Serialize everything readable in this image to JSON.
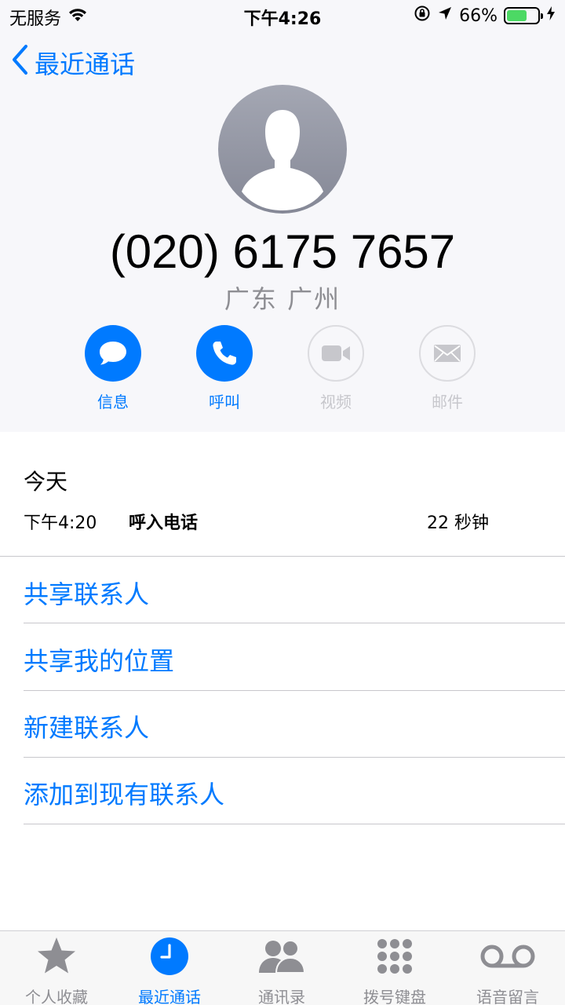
{
  "status_bar": {
    "carrier": "无服务",
    "time": "下午4:26",
    "battery_percent": "66%",
    "battery_level": 0.66
  },
  "nav": {
    "back_label": "最近通话"
  },
  "contact": {
    "phone_number": "(020) 6175 7657",
    "location": "广东 广州"
  },
  "actions": [
    {
      "label": "信息",
      "icon": "message-icon",
      "enabled": true
    },
    {
      "label": "呼叫",
      "icon": "phone-icon",
      "enabled": true
    },
    {
      "label": "视频",
      "icon": "video-icon",
      "enabled": false
    },
    {
      "label": "邮件",
      "icon": "mail-icon",
      "enabled": false
    }
  ],
  "call_history": {
    "day": "今天",
    "entries": [
      {
        "time": "下午4:20",
        "type": "呼入电话",
        "duration": "22 秒钟"
      }
    ]
  },
  "options": [
    {
      "label": "共享联系人"
    },
    {
      "label": "共享我的位置"
    },
    {
      "label": "新建联系人"
    },
    {
      "label": "添加到现有联系人"
    }
  ],
  "tab_bar": {
    "tabs": [
      {
        "label": "个人收藏",
        "icon": "star-icon",
        "active": false
      },
      {
        "label": "最近通话",
        "icon": "clock-icon",
        "active": true
      },
      {
        "label": "通讯录",
        "icon": "contacts-icon",
        "active": false
      },
      {
        "label": "拨号键盘",
        "icon": "keypad-icon",
        "active": false
      },
      {
        "label": "语音留言",
        "icon": "voicemail-icon",
        "active": false
      }
    ]
  },
  "colors": {
    "accent": "#007aff",
    "disabled": "#c7c7cc",
    "header_bg": "#f7f7fa",
    "battery_fill": "#4cd964"
  }
}
